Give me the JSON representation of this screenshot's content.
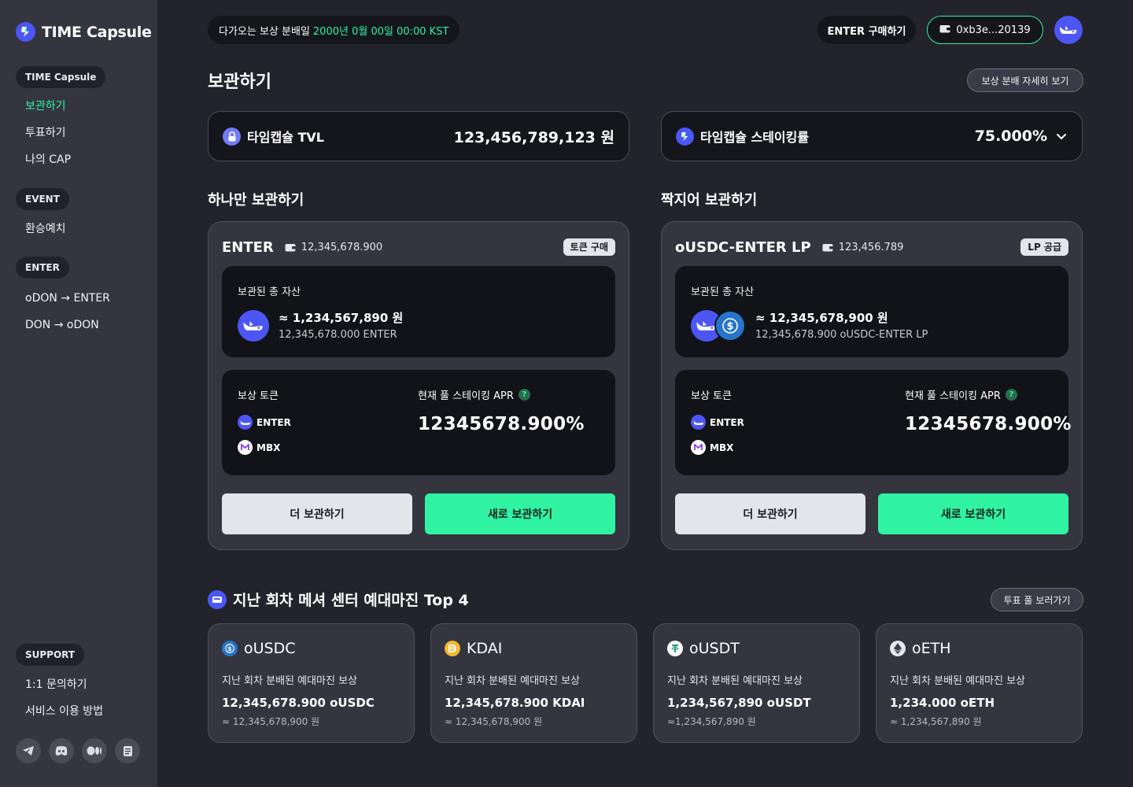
{
  "brand": {
    "name": "TIME Capsule",
    "accent": "#2ff2a3",
    "primary": "#4c56f5"
  },
  "sidebar": {
    "groups": [
      {
        "title": "TIME Capsule",
        "items": [
          {
            "label": "보관하기",
            "active": true
          },
          {
            "label": "투표하기",
            "active": false
          },
          {
            "label": "나의 CAP",
            "active": false
          }
        ]
      },
      {
        "title": "EVENT",
        "items": [
          {
            "label": "환승예치",
            "active": false
          }
        ]
      },
      {
        "title": "ENTER",
        "items": [
          {
            "label": "oDON → ENTER",
            "active": false
          },
          {
            "label": "DON → oDON",
            "active": false
          }
        ]
      }
    ],
    "support": {
      "title": "SUPPORT",
      "items": [
        {
          "label": "1:1 문의하기"
        },
        {
          "label": "서비스 이용 방법"
        }
      ]
    },
    "social_icons": [
      "telegram-icon",
      "discord-icon",
      "medium-icon",
      "docs-icon"
    ]
  },
  "topbar": {
    "schedule_prefix": "다가오는 보상 분배일",
    "schedule_date": "2000년 0월 00일 00:00 KST",
    "buy_enter": "ENTER 구매하기",
    "wallet_address": "0xb3e...20139"
  },
  "page": {
    "title": "보관하기",
    "detail_button": "보상 분배 자세히 보기"
  },
  "stats": {
    "tvl": {
      "label": "타임캡슐 TVL",
      "value": "123,456,789,123 원"
    },
    "staking_rate": {
      "label": "타임캡슐 스테이킹률",
      "value": "75.000%"
    }
  },
  "sections": {
    "single": "하나만 보관하기",
    "pair": "짝지어 보관하기"
  },
  "pools": [
    {
      "name": "ENTER",
      "balance": "12,345,678.900",
      "tag": "토큰 구매",
      "asset_label": "보관된 총 자산",
      "asset_krw": "≈ 1,234,567,890 원",
      "asset_amount": "12,345,678.000 ENTER",
      "reward_label": "보상 토큰",
      "reward_tokens": [
        "ENTER",
        "MBX"
      ],
      "apr_label": "현재 풀 스테이킹 APR",
      "apr_value": "12345678.900%",
      "btn_more": "더 보관하기",
      "btn_new": "새로 보관하기"
    },
    {
      "name": "oUSDC-ENTER LP",
      "balance": "123,456.789",
      "tag": "LP 공급",
      "asset_label": "보관된 총 자산",
      "asset_krw": "≈ 12,345,678,900 원",
      "asset_amount": "12,345,678.900 oUSDC-ENTER LP",
      "reward_label": "보상 토큰",
      "reward_tokens": [
        "ENTER",
        "MBX"
      ],
      "apr_label": "현재 풀 스테이킹 APR",
      "apr_value": "12345678.900%",
      "btn_more": "더 보관하기",
      "btn_new": "새로 보관하기"
    }
  ],
  "top4": {
    "title": "지난 회차 메셔 센터 예대마진 Top 4",
    "vote_button": "투표 풀 보러가기",
    "cards": [
      {
        "token": "oUSDC",
        "label": "지난 회차 분배된 예대마진 보상",
        "amount": "12,345,678.900 oUSDC",
        "krw": "≈ 12,345,678,900 원",
        "color": "#2775ca"
      },
      {
        "token": "KDAI",
        "label": "지난 회차 분배된 예대마진 보상",
        "amount": "12,345,678.900 KDAI",
        "krw": "≈ 12,345,678,900 원",
        "color": "#f4b731"
      },
      {
        "token": "oUSDT",
        "label": "지난 회차 분배된 예대마진 보상",
        "amount": "1,234,567,890 oUSDT",
        "krw": "≈1,234,567,890 원",
        "color": "#26a17b"
      },
      {
        "token": "oETH",
        "label": "지난 회차 분배된 예대마진 보상",
        "amount": "1,234.000 oETH",
        "krw": "≈ 1,234,567,890 원",
        "color": "#e6e6ec"
      }
    ]
  }
}
